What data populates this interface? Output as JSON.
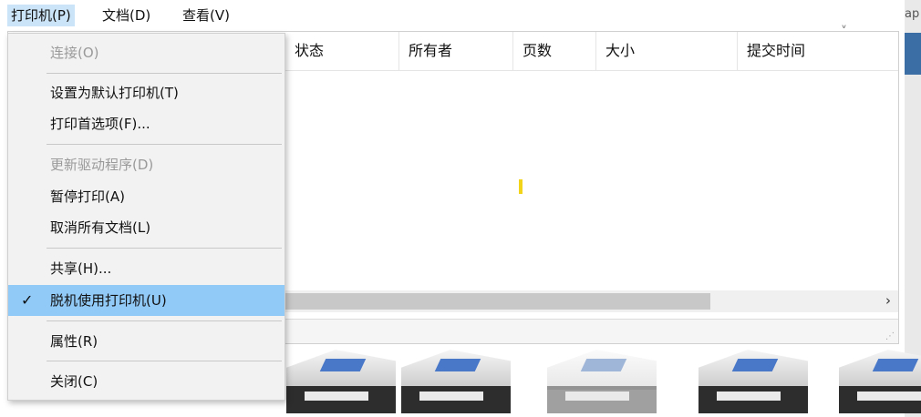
{
  "menubar": {
    "items": [
      {
        "label": "打印机(P)"
      },
      {
        "label": "文档(D)"
      },
      {
        "label": "查看(V)"
      }
    ]
  },
  "background_window": {
    "partial_text": "ap"
  },
  "columns": [
    {
      "label": "状态"
    },
    {
      "label": "所有者"
    },
    {
      "label": "页数"
    },
    {
      "label": "大小"
    },
    {
      "label": "提交时间"
    }
  ],
  "sort_indicator": "˅",
  "scrollbar": {
    "right_arrow": "›"
  },
  "status": {
    "grip": "⋰"
  },
  "printer_menu": {
    "items": [
      {
        "label": "连接(O)",
        "disabled": true
      },
      {
        "label": "设置为默认打印机(T)"
      },
      {
        "label": "打印首选项(F)..."
      },
      {
        "label": "更新驱动程序(D)",
        "disabled": true
      },
      {
        "label": "暂停打印(A)"
      },
      {
        "label": "取消所有文档(L)"
      },
      {
        "label": "共享(H)..."
      },
      {
        "label": "脱机使用打印机(U)",
        "checked": true
      },
      {
        "label": "属性(R)"
      },
      {
        "label": "关闭(C)"
      }
    ],
    "check_glyph": "✓"
  },
  "printers": {
    "count": 5
  }
}
